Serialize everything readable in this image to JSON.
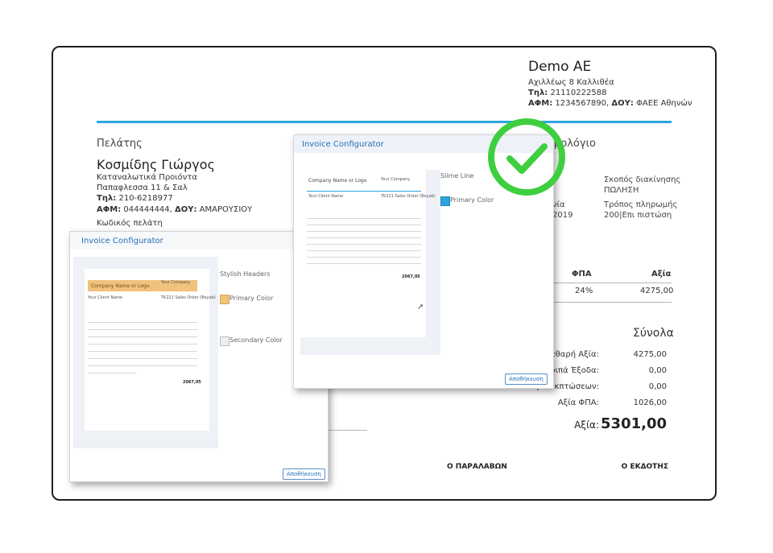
{
  "invoice": {
    "company": {
      "name": "Demo AE",
      "address": "Αχιλλέως 8 Καλλιθέα",
      "phone_label": "Τηλ:",
      "phone": "21110222588",
      "vat_label": "ΑΦΜ:",
      "vat": "1234567890,",
      "tax_office_label": "ΔΟΥ:",
      "tax_office": "ΦΑΕΕ Αθηνών"
    },
    "customer": {
      "section_title": "Πελάτης",
      "name": "Κοσμίδης Γιώργος",
      "line1": "Καταναλωτικά Προιόντα",
      "line2": "Παπαφλεσσα 11 & Σαλ",
      "phone_label": "Τηλ:",
      "phone": "210-6218977",
      "vat_label": "ΑΦΜ:",
      "vat": "044444444,",
      "tax_office_label": "ΔΟΥ:",
      "tax_office": "ΑΜΑΡΟΥΣΙΟΥ",
      "code_label": "Κωδικός πελάτη"
    },
    "doc_title_partial": "μολόγιο",
    "info": {
      "purpose_label": "Σκοπός διακίνησης",
      "purpose_value": "ΠΩΛΗΣΗ",
      "date_label_partial": "νία",
      "payment_label": "Τρόπος πληρωμής",
      "payment_value": "200|Επι πιστώση",
      "date_partial": "2019"
    },
    "table": {
      "vat_header": "ΦΠΑ",
      "value_header": "Αξία",
      "vat_value": "24%",
      "value_value": "4275,00"
    },
    "totals": {
      "title": "Σύνολα",
      "net_label": "Καθαρή Αξία:",
      "net_value": "4275,00",
      "other_label": "Λοιπά Έξοδα:",
      "other_value": "0,00",
      "discount_label": "Αξία Εκπτώσεων:",
      "discount_value": "0,00",
      "vat_label": "Αξία ΦΠΑ:",
      "vat_value": "1026,00",
      "total_label": "Αξία:",
      "total_value": "5301,00"
    },
    "signatures": {
      "receiver": "Ο ΠΑΡΑΛΑΒΩΝ",
      "issuer": "Ο ΕΚΔΟΤΗΣ"
    }
  },
  "configurator_back": {
    "title": "Invoice Configurator",
    "style_name": "Stylish Headers",
    "primary_color_label": "Primary Color",
    "secondary_color_label": "Secondary Color",
    "primary_color": "#f0c27b",
    "secondary_color": "#eeeeee",
    "save_label": "Αποθήκευση",
    "preview": {
      "company_placeholder": "Company Name or Logo",
      "right_company": "Your Company",
      "client_name": "Your Client Name",
      "order_ref": "TK221 Sales Order (Beyab)",
      "total": "2067,05"
    }
  },
  "configurator_front": {
    "title": "Invoice Configurator",
    "style_name": "Slime Line",
    "primary_color_label": "Primary Color",
    "primary_color": "#2aa6dd",
    "save_label": "Αποθήκευση",
    "preview": {
      "company_placeholder": "Company Name or Logo",
      "right_company": "Your Company",
      "client_name": "Your Client Name",
      "order_ref": "TK221 Sales Order (Beyab)",
      "total": "2067,05"
    }
  },
  "success_badge": {
    "icon": "check-circle-icon",
    "color": "#3fce3f"
  },
  "colors": {
    "accent": "#2aa6dd",
    "link": "#2470b8"
  }
}
